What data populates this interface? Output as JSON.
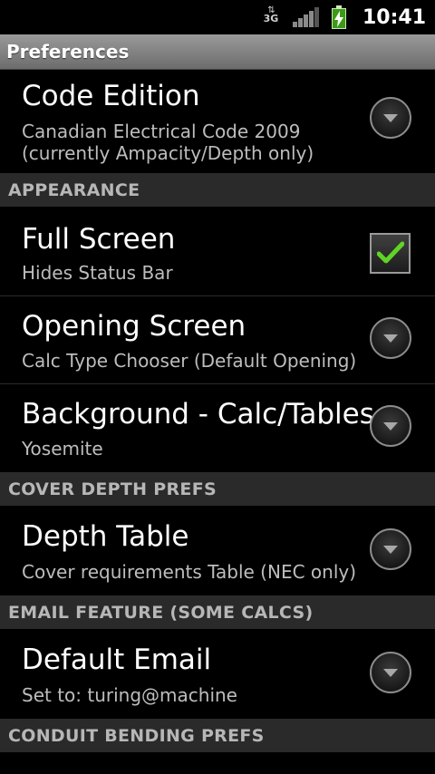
{
  "status_bar": {
    "network_type": "3G",
    "time": "10:41",
    "icons": [
      "data-arrows-icon",
      "signal-icon",
      "battery-charging-icon"
    ]
  },
  "title_bar": {
    "title": "Preferences"
  },
  "prefs": [
    {
      "title": "Code Edition",
      "summary": "Canadian Electrical Code 2009\n(currently Ampacity/Depth only)",
      "widget": "dropdown"
    },
    {
      "category": "APPEARANCE"
    },
    {
      "title": "Full Screen",
      "summary": "Hides Status Bar",
      "widget": "checkbox",
      "checked": true
    },
    {
      "title": "Opening Screen",
      "summary": "Calc Type Chooser (Default Opening)",
      "widget": "dropdown"
    },
    {
      "title": "Background - Calc/Tables",
      "summary": "Yosemite",
      "widget": "dropdown"
    },
    {
      "category": "COVER DEPTH PREFS"
    },
    {
      "title": "Depth Table",
      "summary": "Cover requirements Table (NEC only)",
      "widget": "dropdown"
    },
    {
      "category": "EMAIL FEATURE (SOME CALCS)"
    },
    {
      "title": "Default Email",
      "summary": "Set to: turing@machine",
      "widget": "dropdown"
    },
    {
      "category": "CONDUIT BENDING PREFS"
    }
  ],
  "colors": {
    "checkmark": "#5fd326",
    "category_bg": "#2a2a2a",
    "summary_text": "#bdbdbd"
  }
}
